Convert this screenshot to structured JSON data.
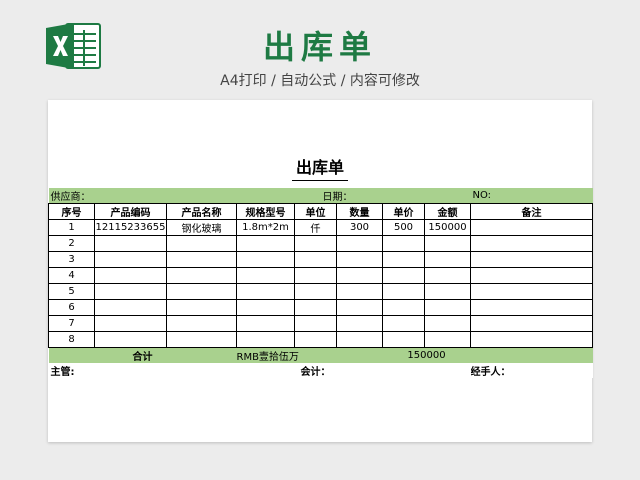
{
  "header": {
    "title": "出库单",
    "subtitle": "A4打印 / 自动公式 / 内容可修改",
    "logo_icon": "excel-logo-icon",
    "accent": "#1e7a43"
  },
  "form": {
    "title": "出库单",
    "supplier_label": "供应商：",
    "date_label": "日期：",
    "no_label": "NO:",
    "columns": [
      "序号",
      "产品编码",
      "产品名称",
      "规格型号",
      "单位",
      "数量",
      "单价",
      "金额",
      "备注"
    ],
    "rows": [
      [
        "1",
        "12115233655",
        "钢化玻璃",
        "1.8m*2m",
        "仟",
        "300",
        "500",
        "150000",
        ""
      ],
      [
        "2",
        "",
        "",
        "",
        "",
        "",
        "",
        "",
        ""
      ],
      [
        "3",
        "",
        "",
        "",
        "",
        "",
        "",
        "",
        ""
      ],
      [
        "4",
        "",
        "",
        "",
        "",
        "",
        "",
        "",
        ""
      ],
      [
        "5",
        "",
        "",
        "",
        "",
        "",
        "",
        "",
        ""
      ],
      [
        "6",
        "",
        "",
        "",
        "",
        "",
        "",
        "",
        ""
      ],
      [
        "7",
        "",
        "",
        "",
        "",
        "",
        "",
        "",
        ""
      ],
      [
        "8",
        "",
        "",
        "",
        "",
        "",
        "",
        "",
        ""
      ]
    ],
    "total": {
      "label": "合计",
      "amount_words": "RMB壹拾伍万",
      "amount": "150000"
    },
    "signatures": {
      "supervisor": "主管:",
      "accountant": "会计：",
      "handler": "经手人："
    },
    "band_color": "#a9d18e"
  }
}
